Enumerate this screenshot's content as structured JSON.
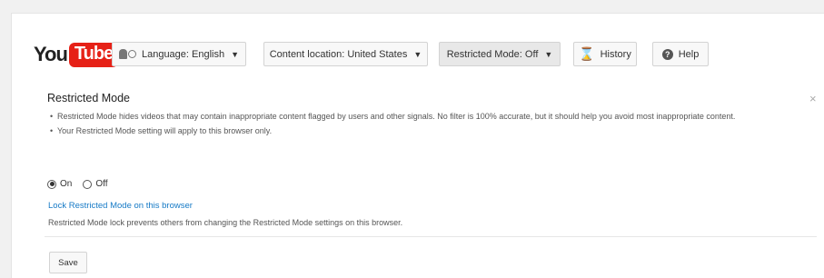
{
  "logo": {
    "you": "You",
    "tube": "Tube"
  },
  "header": {
    "language_label": "Language: English",
    "location_label": "Content location: United States",
    "restricted_label": "Restricted Mode: Off",
    "history_label": "History",
    "help_label": "Help",
    "caret": "▼",
    "help_icon": "?",
    "hourglass_icon": "⌛"
  },
  "panel": {
    "title": "Restricted Mode",
    "close": "×",
    "bullets": [
      "Restricted Mode hides videos that may contain inappropriate content flagged by users and other signals. No filter is 100% accurate, but it should help you avoid most inappropriate content.",
      "Your Restricted Mode setting will apply to this browser only."
    ],
    "radio_on": "On",
    "radio_off": "Off",
    "selected": "On",
    "lock_link": "Lock Restricted Mode on this browser",
    "lock_desc": "Restricted Mode lock prevents others from changing the Restricted Mode settings on this browser.",
    "save_label": "Save"
  },
  "colors": {
    "youtube_red": "#e62117",
    "link_blue": "#167ac6"
  }
}
